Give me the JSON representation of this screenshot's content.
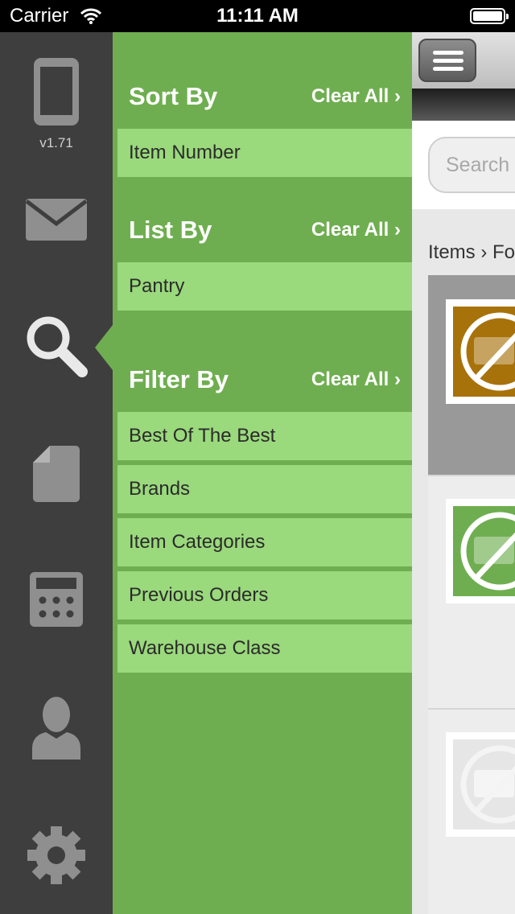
{
  "status_bar": {
    "carrier": "Carrier",
    "time": "11:11 AM"
  },
  "rail": {
    "version": "v1.71",
    "icons": [
      "tablet-icon",
      "mail-icon",
      "search-icon",
      "document-icon",
      "calculator-icon",
      "user-icon",
      "gear-icon"
    ]
  },
  "panel": {
    "sort": {
      "title": "Sort By",
      "clear": "Clear All ›",
      "items": [
        "Item Number"
      ]
    },
    "list": {
      "title": "List By",
      "clear": "Clear All ›",
      "items": [
        "Pantry"
      ]
    },
    "filter": {
      "title": "Filter By",
      "clear": "Clear All ›",
      "items": [
        "Best Of The Best",
        "Brands",
        "Item Categories",
        "Previous Orders",
        "Warehouse Class"
      ]
    }
  },
  "content": {
    "search_placeholder": "Search",
    "breadcrumb": "Items › Fo",
    "thumb_colors": [
      "#a8720b",
      "#6fae50",
      "#e6e6e6"
    ]
  },
  "colors": {
    "panel": "#6fae50",
    "row": "#9ad97c",
    "rail": "#3e3e3e"
  }
}
